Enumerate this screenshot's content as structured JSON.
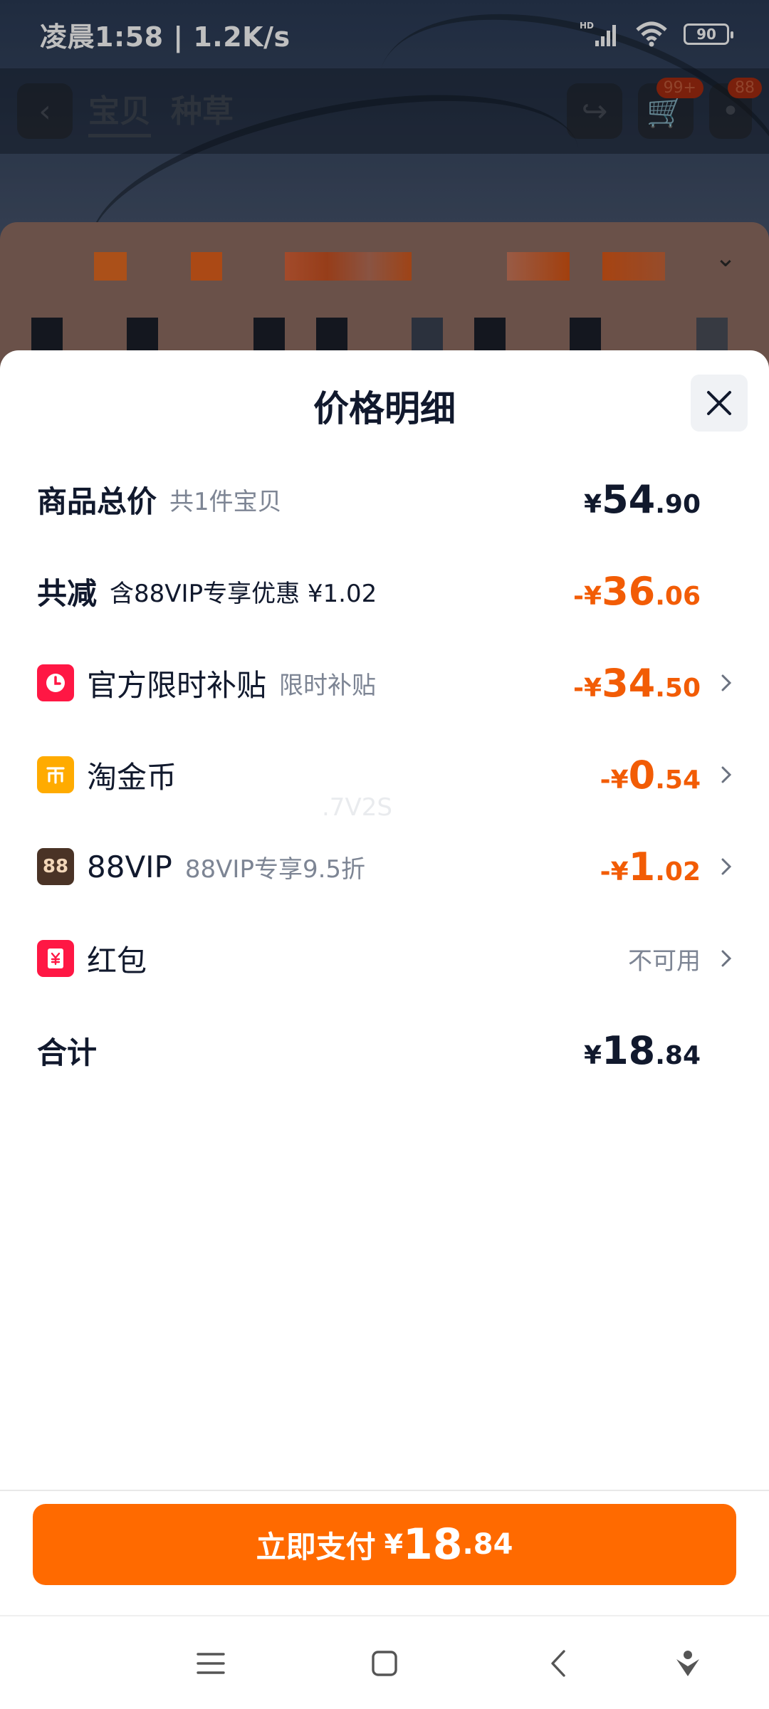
{
  "status_bar": {
    "time": "凌晨1:58 | 1.2K/s",
    "battery": "90",
    "network": "HD"
  },
  "bg_nav": {
    "tabs": [
      "宝贝",
      "种草"
    ],
    "cart_badge": "99+",
    "msg_badge": "88"
  },
  "sheet": {
    "title": "价格明细"
  },
  "rows": [
    {
      "label": "商品总价",
      "sub": "共1件宝贝",
      "currency": "¥",
      "int": "54",
      "dec": ".90"
    },
    {
      "label": "共减",
      "sub": "含88VIP专享优惠 ¥1.02",
      "neg": "-",
      "currency": "¥",
      "int": "36",
      "dec": ".06"
    },
    {
      "icon": "clock-icon",
      "label": "官方限时补贴",
      "sub": "限时补贴",
      "neg": "-",
      "currency": "¥",
      "int": "34",
      "dec": ".50"
    },
    {
      "icon": "coin-icon",
      "label": "淘金币",
      "sub": "",
      "neg": "-",
      "currency": "¥",
      "int": "0",
      "dec": ".54"
    },
    {
      "icon": "vip-icon",
      "icon_text": "88",
      "label": "88VIP",
      "sub": "88VIP专享9.5折",
      "neg": "-",
      "currency": "¥",
      "int": "1",
      "dec": ".02"
    },
    {
      "icon": "redpacket-icon",
      "label": "红包",
      "status": "不可用"
    },
    {
      "label": "合计",
      "currency": "¥",
      "int": "18",
      "dec": ".84"
    }
  ],
  "watermark": ".7V2S",
  "pay_button": {
    "label": "立即支付",
    "currency": "¥",
    "int": "18",
    "dec": ".84"
  },
  "colors": {
    "accent": "#ff6a00",
    "discount": "#f25c05",
    "text": "#11192d",
    "muted": "#7d8594"
  }
}
